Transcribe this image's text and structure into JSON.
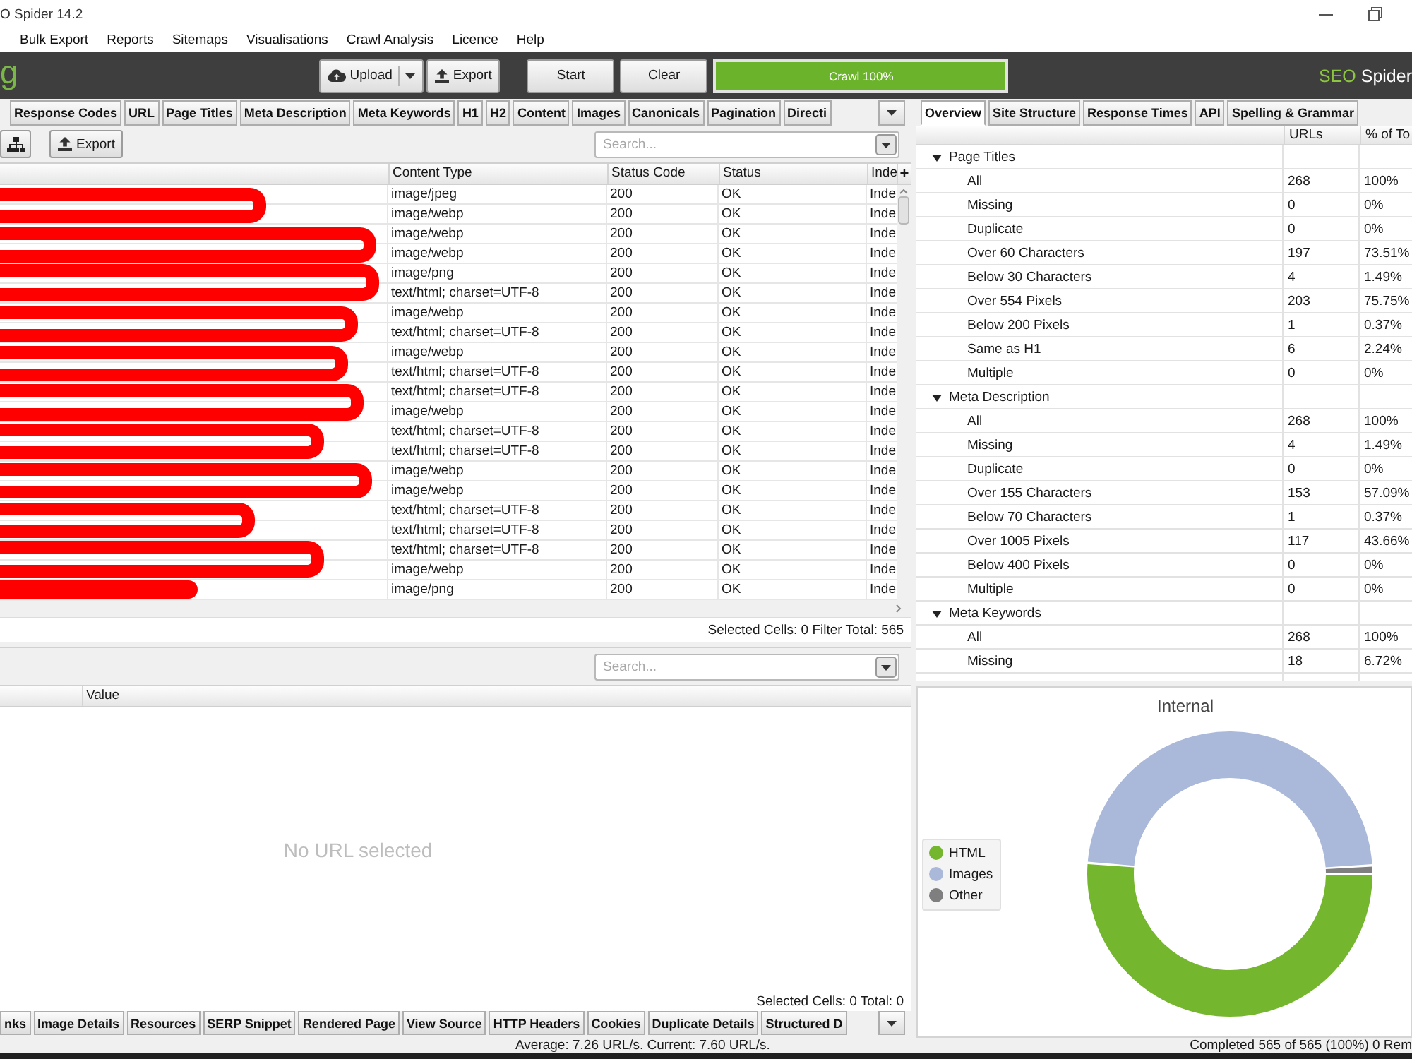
{
  "window": {
    "title": "O Spider 14.2"
  },
  "menu": [
    "Bulk Export",
    "Reports",
    "Sitemaps",
    "Visualisations",
    "Crawl Analysis",
    "Licence",
    "Help"
  ],
  "toolbar": {
    "logo": "g",
    "buttons": [
      {
        "label": "Upload",
        "kind": "upload"
      },
      {
        "label": "Export",
        "kind": "export"
      },
      {
        "label": "Start",
        "kind": "plain"
      },
      {
        "label": "Clear",
        "kind": "plain"
      }
    ],
    "progress": {
      "label": "Crawl 100%",
      "level": 1
    },
    "brand": {
      "prefix": "SEO",
      "name": "Spider"
    }
  },
  "main_tabs": [
    {
      "label": "Response Codes",
      "selected": false
    },
    {
      "label": "URL",
      "selected": false
    },
    {
      "label": "Page Titles",
      "selected": false
    },
    {
      "label": "Meta Description",
      "selected": false
    },
    {
      "label": "Meta Keywords",
      "selected": false
    },
    {
      "label": "H1",
      "selected": false
    },
    {
      "label": "H2",
      "selected": false
    },
    {
      "label": "Content",
      "selected": false
    },
    {
      "label": "Images",
      "selected": false
    },
    {
      "label": "Canonicals",
      "selected": false
    },
    {
      "label": "Pagination",
      "selected": false
    },
    {
      "label": "Directi",
      "selected": false
    }
  ],
  "filter_bar": {
    "export_label": "Export",
    "search": {
      "placeholder": "Search..."
    }
  },
  "table": {
    "columns": [
      "Content Type",
      "Status Code",
      "Status",
      "Inde"
    ],
    "column_button": "+",
    "rows": [
      {
        "content_type": "image/jpeg",
        "status_code": "200",
        "status": "OK",
        "column_4": "Inde"
      },
      {
        "content_type": "image/webp",
        "status_code": "200",
        "status": "OK",
        "column_4": "Inde"
      },
      {
        "content_type": "image/webp",
        "status_code": "200",
        "status": "OK",
        "column_4": "Inde"
      },
      {
        "content_type": "image/webp",
        "status_code": "200",
        "status": "OK",
        "column_4": "Inde"
      },
      {
        "content_type": "image/png",
        "status_code": "200",
        "status": "OK",
        "column_4": "Inde"
      },
      {
        "content_type": "text/html; charset=UTF-8",
        "status_code": "200",
        "status": "OK",
        "column_4": "Inde"
      },
      {
        "content_type": "image/webp",
        "status_code": "200",
        "status": "OK",
        "column_4": "Inde"
      },
      {
        "content_type": "text/html; charset=UTF-8",
        "status_code": "200",
        "status": "OK",
        "column_4": "Inde"
      },
      {
        "content_type": "image/webp",
        "status_code": "200",
        "status": "OK",
        "column_4": "Inde"
      },
      {
        "content_type": "text/html; charset=UTF-8",
        "status_code": "200",
        "status": "OK",
        "column_4": "Inde"
      },
      {
        "content_type": "text/html; charset=UTF-8",
        "status_code": "200",
        "status": "OK",
        "column_4": "Inde"
      },
      {
        "content_type": "image/webp",
        "status_code": "200",
        "status": "OK",
        "column_4": "Inde"
      },
      {
        "content_type": "text/html; charset=UTF-8",
        "status_code": "200",
        "status": "OK",
        "column_4": "Inde"
      },
      {
        "content_type": "text/html; charset=UTF-8",
        "status_code": "200",
        "status": "OK",
        "column_4": "Inde"
      },
      {
        "content_type": "image/webp",
        "status_code": "200",
        "status": "OK",
        "column_4": "Inde"
      },
      {
        "content_type": "image/webp",
        "status_code": "200",
        "status": "OK",
        "column_4": "Inde"
      },
      {
        "content_type": "text/html; charset=UTF-8",
        "status_code": "200",
        "status": "OK",
        "column_4": "Inde"
      },
      {
        "content_type": "text/html; charset=UTF-8",
        "status_code": "200",
        "status": "OK",
        "column_4": "Inde"
      },
      {
        "content_type": "text/html; charset=UTF-8",
        "status_code": "200",
        "status": "OK",
        "column_4": "Inde"
      },
      {
        "content_type": "image/webp",
        "status_code": "200",
        "status": "OK",
        "column_4": "Inde"
      },
      {
        "content_type": "image/png",
        "status_code": "200",
        "status": "OK",
        "column_4": "Inde"
      }
    ],
    "status": "Selected Cells: 0 Filter Total: 565"
  },
  "details_panel": {
    "search": {
      "placeholder": "Search..."
    },
    "columns": [
      "Value"
    ],
    "empty_message": "No URL selected",
    "status": "Selected Cells: 0 Total: 0",
    "tabs": [
      {
        "label": "nks",
        "selected": false
      },
      {
        "label": "Image Details",
        "selected": false
      },
      {
        "label": "Resources",
        "selected": false
      },
      {
        "label": "SERP Snippet",
        "selected": false
      },
      {
        "label": "Rendered Page",
        "selected": false
      },
      {
        "label": "View Source",
        "selected": false
      },
      {
        "label": "HTTP Headers",
        "selected": false
      },
      {
        "label": "Cookies",
        "selected": false
      },
      {
        "label": "Duplicate Details",
        "selected": false
      },
      {
        "label": "Structured D",
        "selected": false
      }
    ]
  },
  "side_tabs": [
    {
      "label": "Overview",
      "selected": true
    },
    {
      "label": "Site Structure",
      "selected": false
    },
    {
      "label": "Response Times",
      "selected": false
    },
    {
      "label": "API",
      "selected": false
    },
    {
      "label": "Spelling & Grammar",
      "selected": false
    }
  ],
  "overview": {
    "columns": [
      "URLs",
      "% of To"
    ],
    "sections": [
      {
        "label": "Page Titles",
        "expanded": true,
        "children": [
          {
            "label": "All",
            "urls": "268",
            "percent": "100%"
          },
          {
            "label": "Missing",
            "urls": "0",
            "percent": "0%"
          },
          {
            "label": "Duplicate",
            "urls": "0",
            "percent": "0%"
          },
          {
            "label": "Over 60 Characters",
            "urls": "197",
            "percent": "73.51%"
          },
          {
            "label": "Below 30 Characters",
            "urls": "4",
            "percent": "1.49%"
          },
          {
            "label": "Over 554 Pixels",
            "urls": "203",
            "percent": "75.75%"
          },
          {
            "label": "Below 200 Pixels",
            "urls": "1",
            "percent": "0.37%"
          },
          {
            "label": "Same as H1",
            "urls": "6",
            "percent": "2.24%"
          },
          {
            "label": "Multiple",
            "urls": "0",
            "percent": "0%"
          }
        ]
      },
      {
        "label": "Meta Description",
        "expanded": true,
        "children": [
          {
            "label": "All",
            "urls": "268",
            "percent": "100%"
          },
          {
            "label": "Missing",
            "urls": "4",
            "percent": "1.49%"
          },
          {
            "label": "Duplicate",
            "urls": "0",
            "percent": "0%"
          },
          {
            "label": "Over 155 Characters",
            "urls": "153",
            "percent": "57.09%"
          },
          {
            "label": "Below 70 Characters",
            "urls": "1",
            "percent": "0.37%"
          },
          {
            "label": "Over 1005 Pixels",
            "urls": "117",
            "percent": "43.66%"
          },
          {
            "label": "Below 400 Pixels",
            "urls": "0",
            "percent": "0%"
          },
          {
            "label": "Multiple",
            "urls": "0",
            "percent": "0%"
          }
        ]
      },
      {
        "label": "Meta Keywords",
        "expanded": true,
        "children": [
          {
            "label": "All",
            "urls": "268",
            "percent": "100%"
          },
          {
            "label": "Missing",
            "urls": "18",
            "percent": "6.72%"
          }
        ]
      }
    ]
  },
  "chart": {
    "title": "Internal",
    "legend": [
      {
        "label": "HTML",
        "color": "#74b72e"
      },
      {
        "label": "Images",
        "color": "#aab8da"
      },
      {
        "label": "Other",
        "color": "#7f7f7f"
      }
    ]
  },
  "status_bar": {
    "speed": "Average: 7.26 URL/s. Current: 7.60 URL/s.",
    "progress": "Completed 565 of 565 (100%) 0 Rem"
  }
}
